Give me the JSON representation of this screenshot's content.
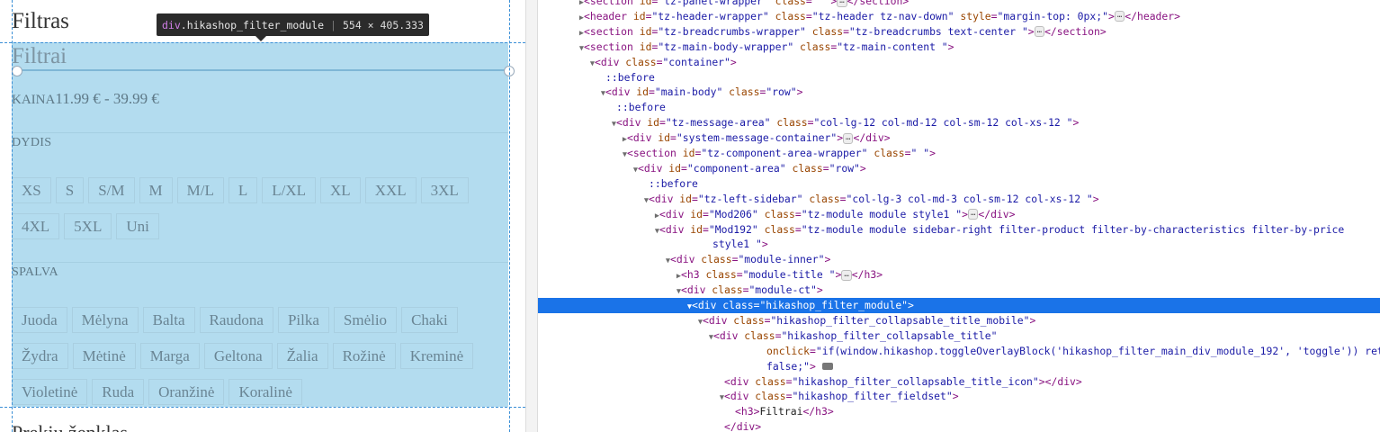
{
  "page": {
    "title": "Filtras",
    "filter_heading": "Filtrai",
    "price_label": "KAINA",
    "price_value": "11.99 € - 39.99 €",
    "size_label": "DYDIS",
    "sizes_row1": [
      "XS",
      "S",
      "S/M",
      "M",
      "M/L",
      "L",
      "L/XL",
      "XL",
      "XXL",
      "3XL"
    ],
    "sizes_row2": [
      "4XL",
      "5XL",
      "Uni"
    ],
    "color_label": "SPALVA",
    "colors_row1": [
      "Juoda",
      "Mėlyna",
      "Balta",
      "Raudona",
      "Pilka",
      "Smėlio",
      "Chaki"
    ],
    "colors_row2": [
      "Žydra",
      "Mėtinė",
      "Marga",
      "Geltona",
      "Žalia",
      "Rožinė",
      "Kreminė"
    ],
    "colors_row3": [
      "Violetinė",
      "Ruda",
      "Oranžinė",
      "Koralinė"
    ],
    "bottom_partial": "Prekių ženklas"
  },
  "tooltip": {
    "element": "div",
    "class": ".hikashop_filter_module",
    "size": "554 × 405.333"
  },
  "devtools": {
    "lines": [
      {
        "indent": 4,
        "tri": "▶",
        "html": "<span class='pun'>&lt;</span><span class='tag'>section</span> <span class='an'>id</span><span class='pun'>=</span><span class='av'>\"tz-panel-wrapper\"</span> <span class='an'>class</span><span class='pun'>=</span><span class='av'>\" \"</span><span class='pun'>&gt;</span><span class='ellip'>…</span><span class='pun'>&lt;/</span><span class='tag'>section</span><span class='pun'>&gt;</span>"
      },
      {
        "indent": 4,
        "tri": "▶",
        "html": "<span class='pun'>&lt;</span><span class='tag'>header</span> <span class='an'>id</span><span class='pun'>=</span><span class='av'>\"tz-header-wrapper\"</span> <span class='an'>class</span><span class='pun'>=</span><span class='av'>\"tz-header tz-nav-down\"</span> <span class='an'>style</span><span class='pun'>=</span><span class='av'>\"margin-top: 0px;\"</span><span class='pun'>&gt;</span><span class='ellip'>…</span><span class='pun'>&lt;/</span><span class='tag'>header</span><span class='pun'>&gt;</span>"
      },
      {
        "indent": 4,
        "tri": "▶",
        "html": "<span class='pun'>&lt;</span><span class='tag'>section</span> <span class='an'>id</span><span class='pun'>=</span><span class='av'>\"tz-breadcrumbs-wrapper\"</span> <span class='an'>class</span><span class='pun'>=</span><span class='av'>\"tz-breadcrumbs text-center \"</span><span class='pun'>&gt;</span><span class='ellip'>…</span><span class='pun'>&lt;/</span><span class='tag'>section</span><span class='pun'>&gt;</span>"
      },
      {
        "indent": 4,
        "tri": "▼",
        "html": "<span class='pun'>&lt;</span><span class='tag'>section</span> <span class='an'>id</span><span class='pun'>=</span><span class='av'>\"tz-main-body-wrapper\"</span> <span class='an'>class</span><span class='pun'>=</span><span class='av'>\"tz-main-content \"</span><span class='pun'>&gt;</span>"
      },
      {
        "indent": 16,
        "tri": "▼",
        "html": "<span class='pun'>&lt;</span><span class='tag'>div</span> <span class='an'>class</span><span class='pun'>=</span><span class='av'>\"container\"</span><span class='pun'>&gt;</span>"
      },
      {
        "indent": 28,
        "tri": "",
        "html": "<span class='pseudo'>::before</span>"
      },
      {
        "indent": 28,
        "tri": "▼",
        "html": "<span class='pun'>&lt;</span><span class='tag'>div</span> <span class='an'>id</span><span class='pun'>=</span><span class='av'>\"main-body\"</span> <span class='an'>class</span><span class='pun'>=</span><span class='av'>\"row\"</span><span class='pun'>&gt;</span>"
      },
      {
        "indent": 40,
        "tri": "",
        "html": "<span class='pseudo'>::before</span>"
      },
      {
        "indent": 40,
        "tri": "▼",
        "html": "<span class='pun'>&lt;</span><span class='tag'>div</span> <span class='an'>id</span><span class='pun'>=</span><span class='av'>\"tz-message-area\"</span> <span class='an'>class</span><span class='pun'>=</span><span class='av'>\"col-lg-12 col-md-12 col-sm-12 col-xs-12 \"</span><span class='pun'>&gt;</span>"
      },
      {
        "indent": 52,
        "tri": "▶",
        "html": "<span class='pun'>&lt;</span><span class='tag'>div</span> <span class='an'>id</span><span class='pun'>=</span><span class='av'>\"system-message-container\"</span><span class='pun'>&gt;</span><span class='ellip'>…</span><span class='pun'>&lt;/</span><span class='tag'>div</span><span class='pun'>&gt;</span>"
      },
      {
        "indent": 52,
        "tri": "▼",
        "html": "<span class='pun'>&lt;</span><span class='tag'>section</span> <span class='an'>id</span><span class='pun'>=</span><span class='av'>\"tz-component-area-wrapper\"</span> <span class='an'>class</span><span class='pun'>=</span><span class='av'>\" \"</span><span class='pun'>&gt;</span>"
      },
      {
        "indent": 64,
        "tri": "▼",
        "html": "<span class='pun'>&lt;</span><span class='tag'>div</span> <span class='an'>id</span><span class='pun'>=</span><span class='av'>\"component-area\"</span> <span class='an'>class</span><span class='pun'>=</span><span class='av'>\"row\"</span><span class='pun'>&gt;</span>"
      },
      {
        "indent": 76,
        "tri": "",
        "html": "<span class='pseudo'>::before</span>"
      },
      {
        "indent": 76,
        "tri": "▼",
        "html": "<span class='pun'>&lt;</span><span class='tag'>div</span> <span class='an'>id</span><span class='pun'>=</span><span class='av'>\"tz-left-sidebar\"</span> <span class='an'>class</span><span class='pun'>=</span><span class='av'>\"col-lg-3 col-md-3 col-sm-12 col-xs-12 \"</span><span class='pun'>&gt;</span>"
      },
      {
        "indent": 88,
        "tri": "▶",
        "html": "<span class='pun'>&lt;</span><span class='tag'>div</span> <span class='an'>id</span><span class='pun'>=</span><span class='av'>\"Mod206\"</span> <span class='an'>class</span><span class='pun'>=</span><span class='av'>\"tz-module module style1 \"</span><span class='pun'>&gt;</span><span class='ellip'>…</span><span class='pun'>&lt;/</span><span class='tag'>div</span><span class='pun'>&gt;</span>"
      },
      {
        "indent": 88,
        "tri": "▼",
        "html": "<span class='pun'>&lt;</span><span class='tag'>div</span> <span class='an'>id</span><span class='pun'>=</span><span class='av'>\"Mod192\"</span> <span class='an'>class</span><span class='pun'>=</span><span class='av'>\"tz-module module sidebar-right filter-product filter-by-characteristics filter-by-price</span>"
      },
      {
        "indent": 147,
        "tri": "",
        "html": "<span class='av'>style1 \"</span><span class='pun'>&gt;</span>"
      },
      {
        "indent": 100,
        "tri": "▼",
        "html": "<span class='pun'>&lt;</span><span class='tag'>div</span> <span class='an'>class</span><span class='pun'>=</span><span class='av'>\"module-inner\"</span><span class='pun'>&gt;</span>"
      },
      {
        "indent": 112,
        "tri": "▶",
        "html": "<span class='pun'>&lt;</span><span class='tag'>h3</span> <span class='an'>class</span><span class='pun'>=</span><span class='av'>\"module-title \"</span><span class='pun'>&gt;</span><span class='ellip'>…</span><span class='pun'>&lt;/</span><span class='tag'>h3</span><span class='pun'>&gt;</span>"
      },
      {
        "indent": 112,
        "tri": "▼",
        "html": "<span class='pun'>&lt;</span><span class='tag'>div</span> <span class='an'>class</span><span class='pun'>=</span><span class='av'>\"module-ct\"</span><span class='pun'>&gt;</span>"
      },
      {
        "indent": 124,
        "tri": "▼",
        "selected": true,
        "html": "<span class='pun'>&lt;</span><span class='tag'>div</span> <span class='an'>class</span><span class='pun'>=</span><span class='av'>\"hikashop_filter_module\"</span><span class='pun'>&gt;</span>"
      },
      {
        "indent": 136,
        "tri": "▼",
        "html": "<span class='pun'>&lt;</span><span class='tag'>div</span> <span class='an'>class</span><span class='pun'>=</span><span class='av'>\"hikashop_filter_collapsable_title_mobile\"</span><span class='pun'>&gt;</span>"
      },
      {
        "indent": 148,
        "tri": "▼",
        "html": "<span class='pun'>&lt;</span><span class='tag'>div</span> <span class='an'>class</span><span class='pun'>=</span><span class='av'>\"hikashop_filter_collapsable_title\"</span>"
      },
      {
        "indent": 207,
        "tri": "",
        "html": "<span class='an'>onclick</span><span class='pun'>=</span><span class='av'>\"if(window.hikashop.toggleOverlayBlock('hikashop_filter_main_div_module_192', 'toggle')) return</span>"
      },
      {
        "indent": 207,
        "tri": "",
        "html": "<span class='av'>false;\"</span><span class='pun'>&gt;</span> <span class='evbadge'></span>"
      },
      {
        "indent": 160,
        "tri": "",
        "html": "<span class='pun'>&lt;</span><span class='tag'>div</span> <span class='an'>class</span><span class='pun'>=</span><span class='av'>\"hikashop_filter_collapsable_title_icon\"</span><span class='pun'>&gt;&lt;/</span><span class='tag'>div</span><span class='pun'>&gt;</span>"
      },
      {
        "indent": 160,
        "tri": "▼",
        "html": "<span class='pun'>&lt;</span><span class='tag'>div</span> <span class='an'>class</span><span class='pun'>=</span><span class='av'>\"hikashop_filter_fieldset\"</span><span class='pun'>&gt;</span>"
      },
      {
        "indent": 172,
        "tri": "",
        "html": "<span class='pun'>&lt;</span><span class='tag'>h3</span><span class='pun'>&gt;</span><span class='txt'>Filtrai</span><span class='pun'>&lt;/</span><span class='tag'>h3</span><span class='pun'>&gt;</span>"
      },
      {
        "indent": 160,
        "tri": "",
        "html": "<span class='pun'>&lt;/</span><span class='tag'>div</span><span class='pun'>&gt;</span>"
      }
    ]
  }
}
